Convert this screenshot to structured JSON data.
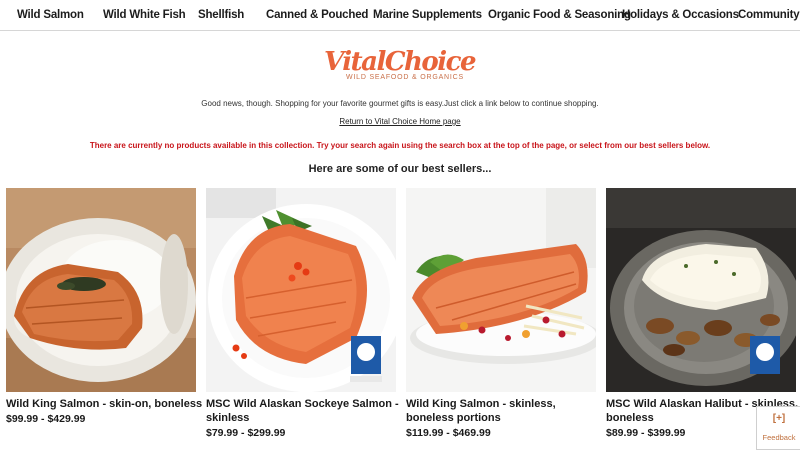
{
  "nav": {
    "items": [
      "Wild Salmon",
      "Wild White Fish",
      "Shellfish",
      "Canned & Pouched",
      "Marine Supplements",
      "Organic Food & Seasoning",
      "Holidays & Occasions",
      "Community"
    ]
  },
  "logo": {
    "name": "VitalChoice",
    "tagline": "WILD SEAFOOD & ORGANICS"
  },
  "messages": {
    "good_news": "Good news, though. Shopping for your favorite gourmet gifts is easy.Just click a link below to continue shopping.",
    "return_link": "Return to Vital Choice Home page",
    "no_products": "There are currently no products available in this collection. Try your search again using the search box at the top of the page, or select from our best sellers below.",
    "best_sellers": "Here are some of our best sellers..."
  },
  "products": [
    {
      "name": "Wild King Salmon - skin-on, boneless",
      "price": "$99.99 - $429.99",
      "image": "salmon-over-rice-photo"
    },
    {
      "name": "MSC Wild Alaskan Sockeye Salmon - skinless",
      "price": "$79.99 - $299.99",
      "image": "sockeye-salmon-plate-photo",
      "badge": "MSC"
    },
    {
      "name": "Wild King Salmon - skinless, boneless portions",
      "price": "$119.99 - $469.99",
      "image": "king-salmon-salad-photo"
    },
    {
      "name": "MSC Wild Alaskan Halibut - skinless, boneless",
      "price": "$89.99 - $399.99",
      "image": "halibut-mushrooms-photo",
      "badge": "MSC"
    }
  ],
  "feedback": {
    "icon": "[+]",
    "label": "Feedback"
  },
  "colors": {
    "brand": "#e8643a",
    "alert": "#c8141a"
  }
}
